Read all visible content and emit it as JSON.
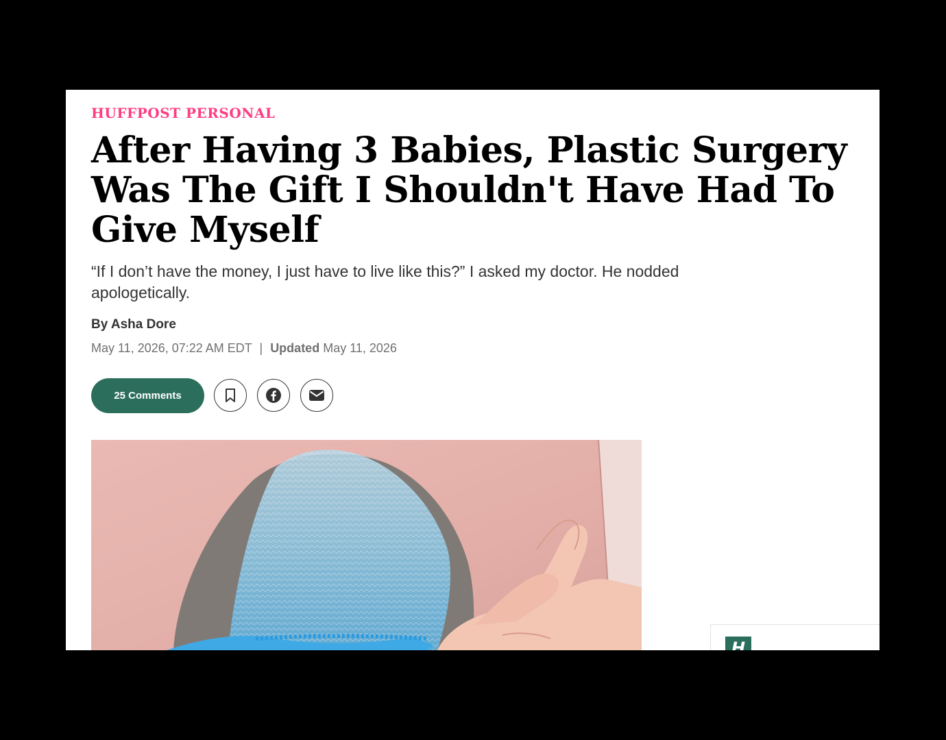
{
  "article": {
    "section": "HUFFPOST PERSONAL",
    "headline": "After Having 3 Babies, Plastic Surgery Was The Gift I Shouldn't Have Had To Give Myself",
    "dek": "“If I don’t have the money, I just have to live like this?” I asked my doctor. He nodded apologetically.",
    "byline": "By Asha Dore",
    "published": "May 11, 2026, 07:22 AM EDT",
    "separator": "|",
    "updated_label": "Updated",
    "updated_date": "May 11, 2026"
  },
  "share": {
    "comments_label": "25 Comments",
    "icons": [
      "bookmark-icon",
      "facebook-icon",
      "email-icon"
    ]
  },
  "sidebar": {
    "logo_text": "H"
  },
  "colors": {
    "section": "#ff3d83",
    "accent": "#2c6e5c",
    "background": "#000000"
  }
}
